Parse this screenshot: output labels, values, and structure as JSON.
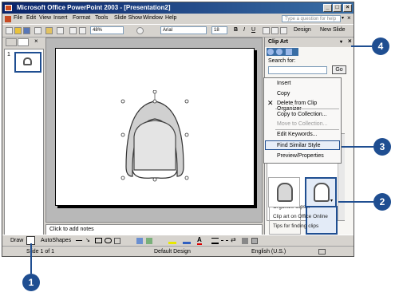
{
  "window": {
    "title": "Microsoft Office PowerPoint 2003 - [Presentation2]"
  },
  "menu": [
    "File",
    "Edit",
    "View",
    "Insert",
    "Format",
    "Tools",
    "Slide Show",
    "Window",
    "Help"
  ],
  "help_placeholder": "Type a question for help",
  "toolbar": {
    "zoom": "48%",
    "font": "Arial",
    "size": "18",
    "bold": "B",
    "italic": "I",
    "underline": "U",
    "design": "Design",
    "new_slide": "New Slide"
  },
  "thumb": {
    "number": "1"
  },
  "notes": "Click to add notes",
  "drawbar": {
    "draw": "Draw",
    "autoshapes": "AutoShapes"
  },
  "status": {
    "slide": "Slide 1 of 1",
    "design": "Default Design",
    "language": "English (U.S.)"
  },
  "taskpane": {
    "title": "Clip Art",
    "search_for": "Search for:",
    "go": "Go",
    "links": [
      "Organize clips...",
      "Clip art on Office Online",
      "Tips for finding clips"
    ]
  },
  "context_menu": [
    "Insert",
    "Copy",
    "Delete from Clip Organizer",
    "Copy to Collection...",
    "Move to Collection...",
    "Edit Keywords...",
    "Find Similar Style",
    "Preview/Properties"
  ],
  "callouts": [
    "1",
    "2",
    "3",
    "4"
  ]
}
